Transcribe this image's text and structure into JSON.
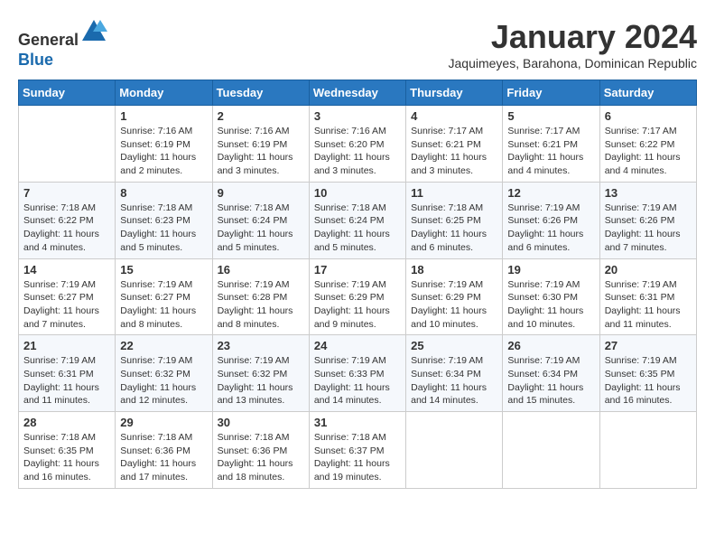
{
  "header": {
    "logo_line1": "General",
    "logo_line2": "Blue",
    "title": "January 2024",
    "subtitle": "Jaquimeyes, Barahona, Dominican Republic"
  },
  "weekdays": [
    "Sunday",
    "Monday",
    "Tuesday",
    "Wednesday",
    "Thursday",
    "Friday",
    "Saturday"
  ],
  "weeks": [
    [
      {
        "day": "",
        "info": ""
      },
      {
        "day": "1",
        "info": "Sunrise: 7:16 AM\nSunset: 6:19 PM\nDaylight: 11 hours\nand 2 minutes."
      },
      {
        "day": "2",
        "info": "Sunrise: 7:16 AM\nSunset: 6:19 PM\nDaylight: 11 hours\nand 3 minutes."
      },
      {
        "day": "3",
        "info": "Sunrise: 7:16 AM\nSunset: 6:20 PM\nDaylight: 11 hours\nand 3 minutes."
      },
      {
        "day": "4",
        "info": "Sunrise: 7:17 AM\nSunset: 6:21 PM\nDaylight: 11 hours\nand 3 minutes."
      },
      {
        "day": "5",
        "info": "Sunrise: 7:17 AM\nSunset: 6:21 PM\nDaylight: 11 hours\nand 4 minutes."
      },
      {
        "day": "6",
        "info": "Sunrise: 7:17 AM\nSunset: 6:22 PM\nDaylight: 11 hours\nand 4 minutes."
      }
    ],
    [
      {
        "day": "7",
        "info": "Sunrise: 7:18 AM\nSunset: 6:22 PM\nDaylight: 11 hours\nand 4 minutes."
      },
      {
        "day": "8",
        "info": "Sunrise: 7:18 AM\nSunset: 6:23 PM\nDaylight: 11 hours\nand 5 minutes."
      },
      {
        "day": "9",
        "info": "Sunrise: 7:18 AM\nSunset: 6:24 PM\nDaylight: 11 hours\nand 5 minutes."
      },
      {
        "day": "10",
        "info": "Sunrise: 7:18 AM\nSunset: 6:24 PM\nDaylight: 11 hours\nand 5 minutes."
      },
      {
        "day": "11",
        "info": "Sunrise: 7:18 AM\nSunset: 6:25 PM\nDaylight: 11 hours\nand 6 minutes."
      },
      {
        "day": "12",
        "info": "Sunrise: 7:19 AM\nSunset: 6:26 PM\nDaylight: 11 hours\nand 6 minutes."
      },
      {
        "day": "13",
        "info": "Sunrise: 7:19 AM\nSunset: 6:26 PM\nDaylight: 11 hours\nand 7 minutes."
      }
    ],
    [
      {
        "day": "14",
        "info": "Sunrise: 7:19 AM\nSunset: 6:27 PM\nDaylight: 11 hours\nand 7 minutes."
      },
      {
        "day": "15",
        "info": "Sunrise: 7:19 AM\nSunset: 6:27 PM\nDaylight: 11 hours\nand 8 minutes."
      },
      {
        "day": "16",
        "info": "Sunrise: 7:19 AM\nSunset: 6:28 PM\nDaylight: 11 hours\nand 8 minutes."
      },
      {
        "day": "17",
        "info": "Sunrise: 7:19 AM\nSunset: 6:29 PM\nDaylight: 11 hours\nand 9 minutes."
      },
      {
        "day": "18",
        "info": "Sunrise: 7:19 AM\nSunset: 6:29 PM\nDaylight: 11 hours\nand 10 minutes."
      },
      {
        "day": "19",
        "info": "Sunrise: 7:19 AM\nSunset: 6:30 PM\nDaylight: 11 hours\nand 10 minutes."
      },
      {
        "day": "20",
        "info": "Sunrise: 7:19 AM\nSunset: 6:31 PM\nDaylight: 11 hours\nand 11 minutes."
      }
    ],
    [
      {
        "day": "21",
        "info": "Sunrise: 7:19 AM\nSunset: 6:31 PM\nDaylight: 11 hours\nand 11 minutes."
      },
      {
        "day": "22",
        "info": "Sunrise: 7:19 AM\nSunset: 6:32 PM\nDaylight: 11 hours\nand 12 minutes."
      },
      {
        "day": "23",
        "info": "Sunrise: 7:19 AM\nSunset: 6:32 PM\nDaylight: 11 hours\nand 13 minutes."
      },
      {
        "day": "24",
        "info": "Sunrise: 7:19 AM\nSunset: 6:33 PM\nDaylight: 11 hours\nand 14 minutes."
      },
      {
        "day": "25",
        "info": "Sunrise: 7:19 AM\nSunset: 6:34 PM\nDaylight: 11 hours\nand 14 minutes."
      },
      {
        "day": "26",
        "info": "Sunrise: 7:19 AM\nSunset: 6:34 PM\nDaylight: 11 hours\nand 15 minutes."
      },
      {
        "day": "27",
        "info": "Sunrise: 7:19 AM\nSunset: 6:35 PM\nDaylight: 11 hours\nand 16 minutes."
      }
    ],
    [
      {
        "day": "28",
        "info": "Sunrise: 7:18 AM\nSunset: 6:35 PM\nDaylight: 11 hours\nand 16 minutes."
      },
      {
        "day": "29",
        "info": "Sunrise: 7:18 AM\nSunset: 6:36 PM\nDaylight: 11 hours\nand 17 minutes."
      },
      {
        "day": "30",
        "info": "Sunrise: 7:18 AM\nSunset: 6:36 PM\nDaylight: 11 hours\nand 18 minutes."
      },
      {
        "day": "31",
        "info": "Sunrise: 7:18 AM\nSunset: 6:37 PM\nDaylight: 11 hours\nand 19 minutes."
      },
      {
        "day": "",
        "info": ""
      },
      {
        "day": "",
        "info": ""
      },
      {
        "day": "",
        "info": ""
      }
    ]
  ]
}
